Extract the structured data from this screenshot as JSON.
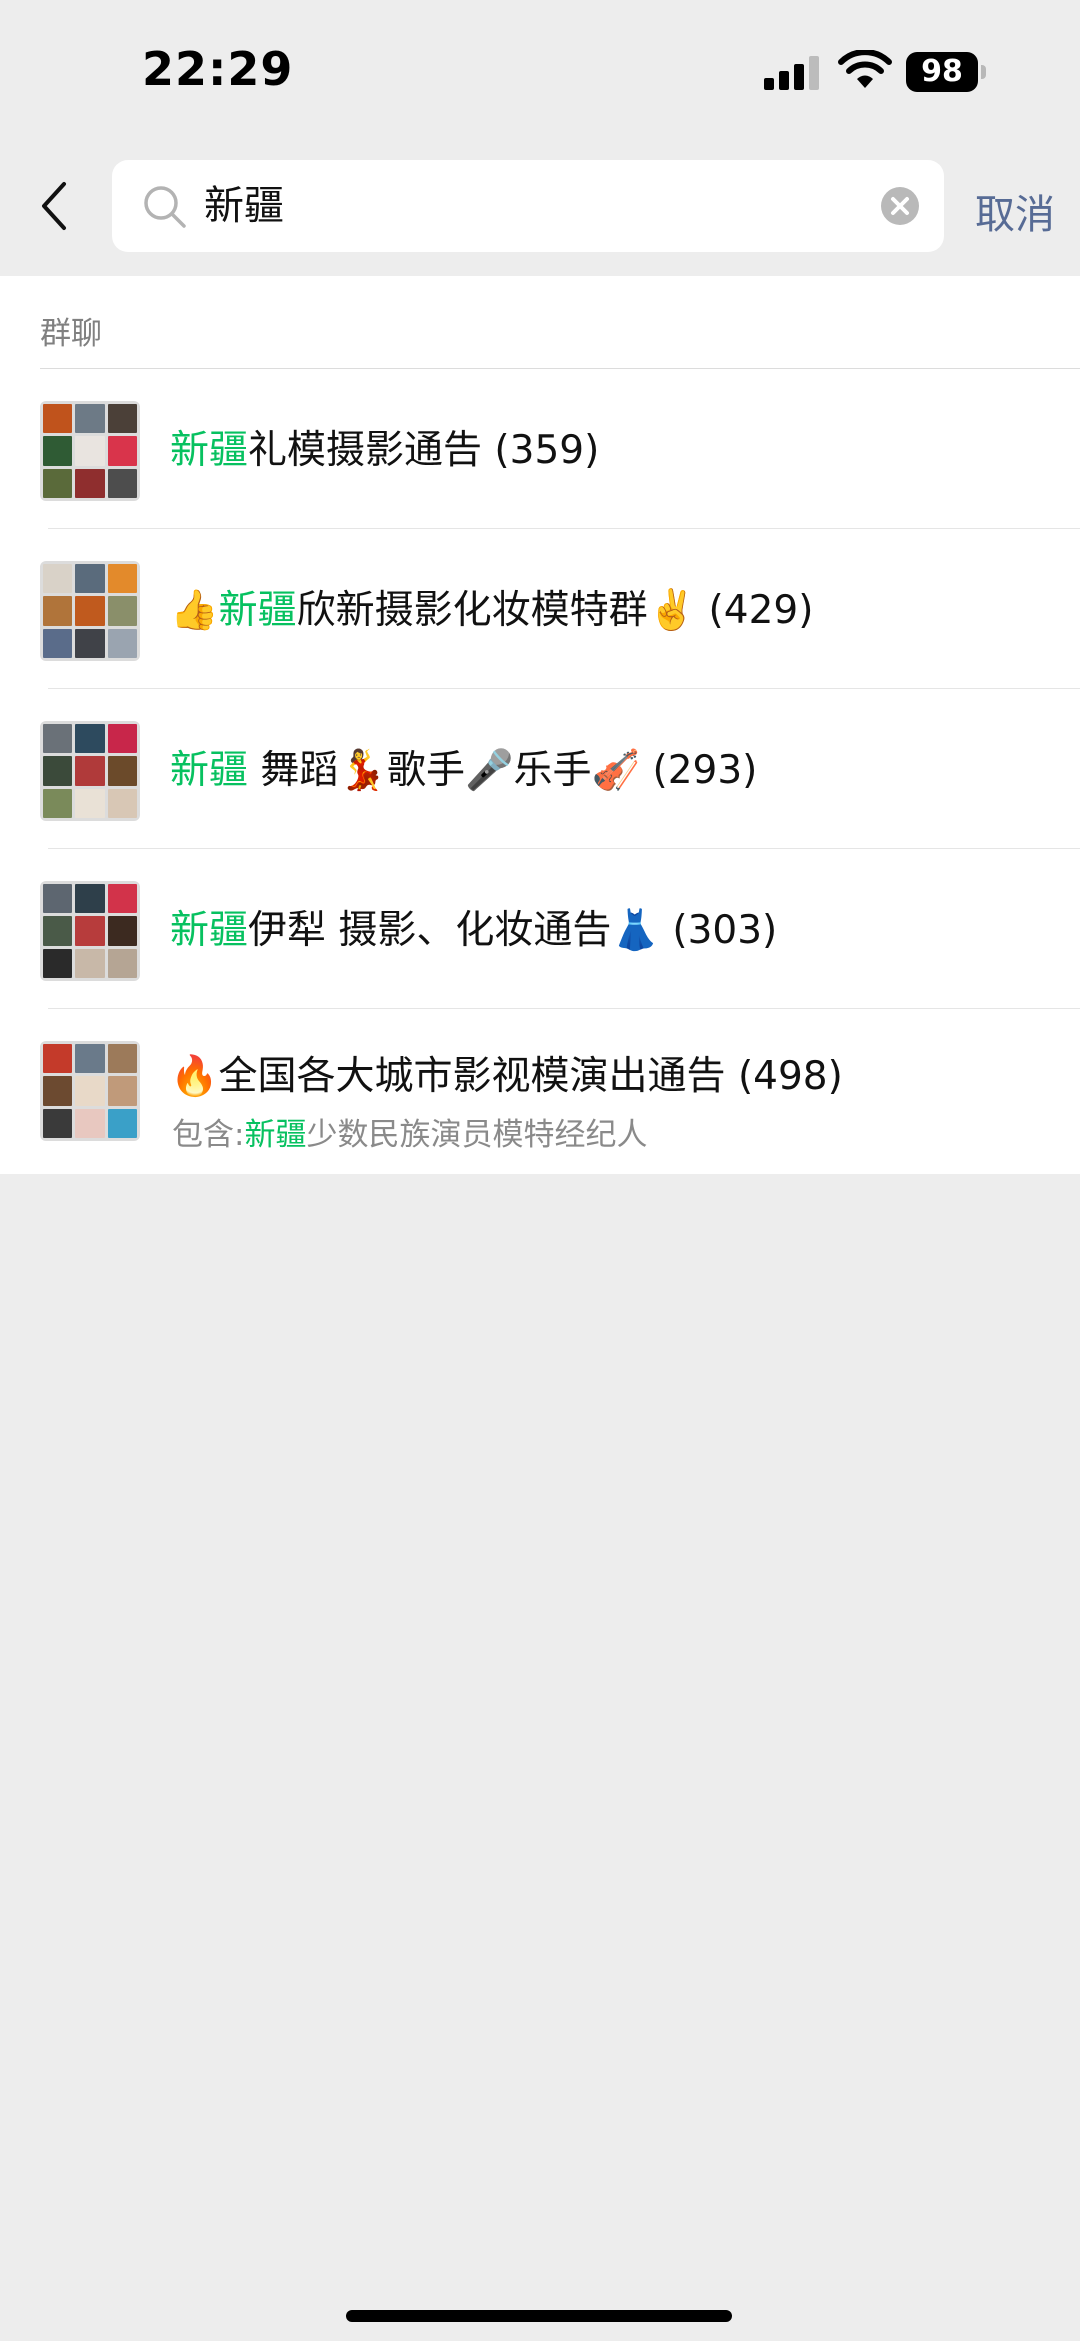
{
  "status_bar": {
    "time": "22:29",
    "battery": "98"
  },
  "search": {
    "query": "新疆",
    "cancel_label": "取消"
  },
  "section": {
    "title": "群聊"
  },
  "results": [
    {
      "prefix": "",
      "highlight": "新疆",
      "rest": "礼模摄影通告 (359)",
      "subtitle_prefix": "",
      "subtitle_highlight": "",
      "subtitle_rest": ""
    },
    {
      "prefix": "👍",
      "highlight": "新疆",
      "rest": "欣新摄影化妆模特群✌️ (429)",
      "subtitle_prefix": "",
      "subtitle_highlight": "",
      "subtitle_rest": ""
    },
    {
      "prefix": "",
      "highlight": "新疆",
      "rest": " 舞蹈💃歌手🎤乐手🎻 (293)",
      "subtitle_prefix": "",
      "subtitle_highlight": "",
      "subtitle_rest": ""
    },
    {
      "prefix": "",
      "highlight": "新疆",
      "rest": "伊犁 摄影、化妆通告👗 (303)",
      "subtitle_prefix": "",
      "subtitle_highlight": "",
      "subtitle_rest": ""
    },
    {
      "prefix": "🔥全国各大城市影视模演出通告 (498)",
      "highlight": "",
      "rest": "",
      "subtitle_prefix": "包含:",
      "subtitle_highlight": "新疆",
      "subtitle_rest": "少数民族演员模特经纪人"
    }
  ],
  "colors": {
    "highlight": "#07c160",
    "link": "#576b95",
    "page_background": "#ededed",
    "avatar_tiles": [
      [
        "#c0531c",
        "#6d7a86",
        "#4b4038",
        "#2f5b34",
        "#e9e4e0",
        "#d9344b",
        "#5a6a3a",
        "#8f2e2e",
        "#4d4d4d"
      ],
      [
        "#d9d2c8",
        "#5a6b7c",
        "#e38a2b",
        "#b0743a",
        "#c05a1e",
        "#8a8f6a",
        "#5a6c8a",
        "#404248",
        "#9aa4b0"
      ],
      [
        "#6a7178",
        "#2d4a5e",
        "#c8264a",
        "#3b4a3a",
        "#b03a3a",
        "#6b4a2a",
        "#7a8a5a",
        "#e9e1d6",
        "#d8c7b5"
      ],
      [
        "#5d6670",
        "#2e3f4a",
        "#d2334a",
        "#4a5a48",
        "#b73c3c",
        "#3c2a20",
        "#2a2a2a",
        "#c8b8a8",
        "#b5a594"
      ],
      [
        "#c43a2a",
        "#6a7a8a",
        "#9c7a5a",
        "#6c4a30",
        "#e8d9c8",
        "#c09a7a",
        "#3a3a3a",
        "#e8c8c0",
        "#3aa0c8"
      ]
    ]
  }
}
